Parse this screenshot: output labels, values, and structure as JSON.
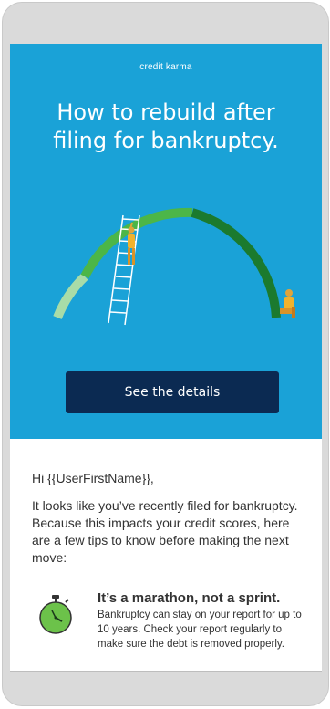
{
  "hero": {
    "brand": "credit karma",
    "headline_line1": "How to rebuild after",
    "headline_line2": "filing for bankruptcy.",
    "cta_label": "See the details"
  },
  "email": {
    "greeting": "Hi {{UserFirstName}},",
    "intro": "It looks like you’ve recently filed for bankruptcy. Because this impacts your credit scores, here are a few tips to know before making the next move:",
    "tips": [
      {
        "icon": "stopwatch-icon",
        "title": "It’s a marathon, not a sprint.",
        "description": "Bankruptcy can stay on your report for up to 10 years. Check your report regularly to make sure the debt is removed properly."
      }
    ]
  },
  "colors": {
    "hero_bg": "#1aa2d7",
    "cta_bg": "#0b2a52",
    "arc_light": "#a8dca8",
    "arc_mid": "#4cb648",
    "arc_dark": "#1b7a2e",
    "stopwatch_green": "#6cc24a"
  }
}
